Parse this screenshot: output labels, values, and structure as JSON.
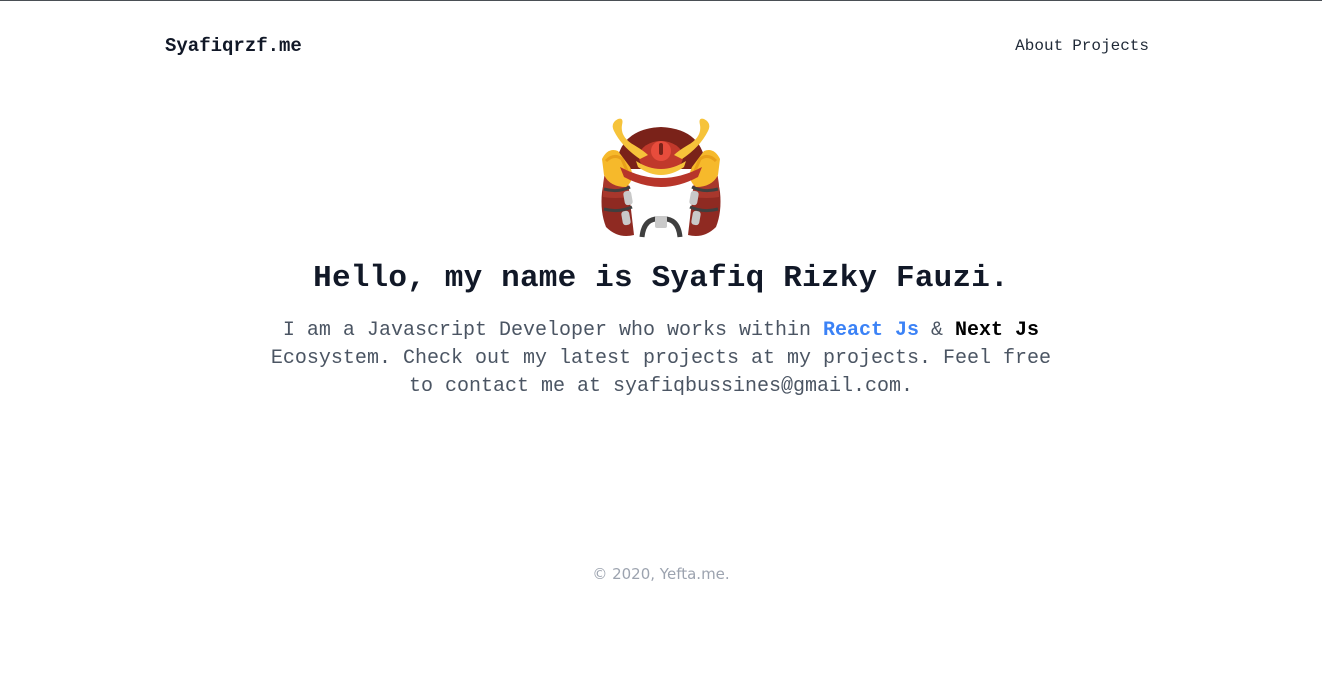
{
  "header": {
    "brand": "Syafiqrzf.me",
    "nav": [
      {
        "label": "About"
      },
      {
        "label": "Projects"
      }
    ]
  },
  "hero": {
    "avatar_icon": "samurai-helmet-icon",
    "title": "Hello, my name is Syafiq Rizky Fauzi.",
    "intro": {
      "part1": "I am a Javascript Developer who works within ",
      "react_link": "React Js",
      "amp": " & ",
      "next_link": "Next Js",
      "part2": " Ecosystem. Check out my latest projects at my ",
      "projects_link": "projects",
      "part3": ". Feel free to contact me at ",
      "email_link": "syafiqbussines@gmail.com",
      "part4": "."
    }
  },
  "footer": {
    "copyright": "© 2020, Yefta.me."
  },
  "colors": {
    "accent": "#3b82f6",
    "text": "#111827",
    "muted": "#9ca3af"
  }
}
